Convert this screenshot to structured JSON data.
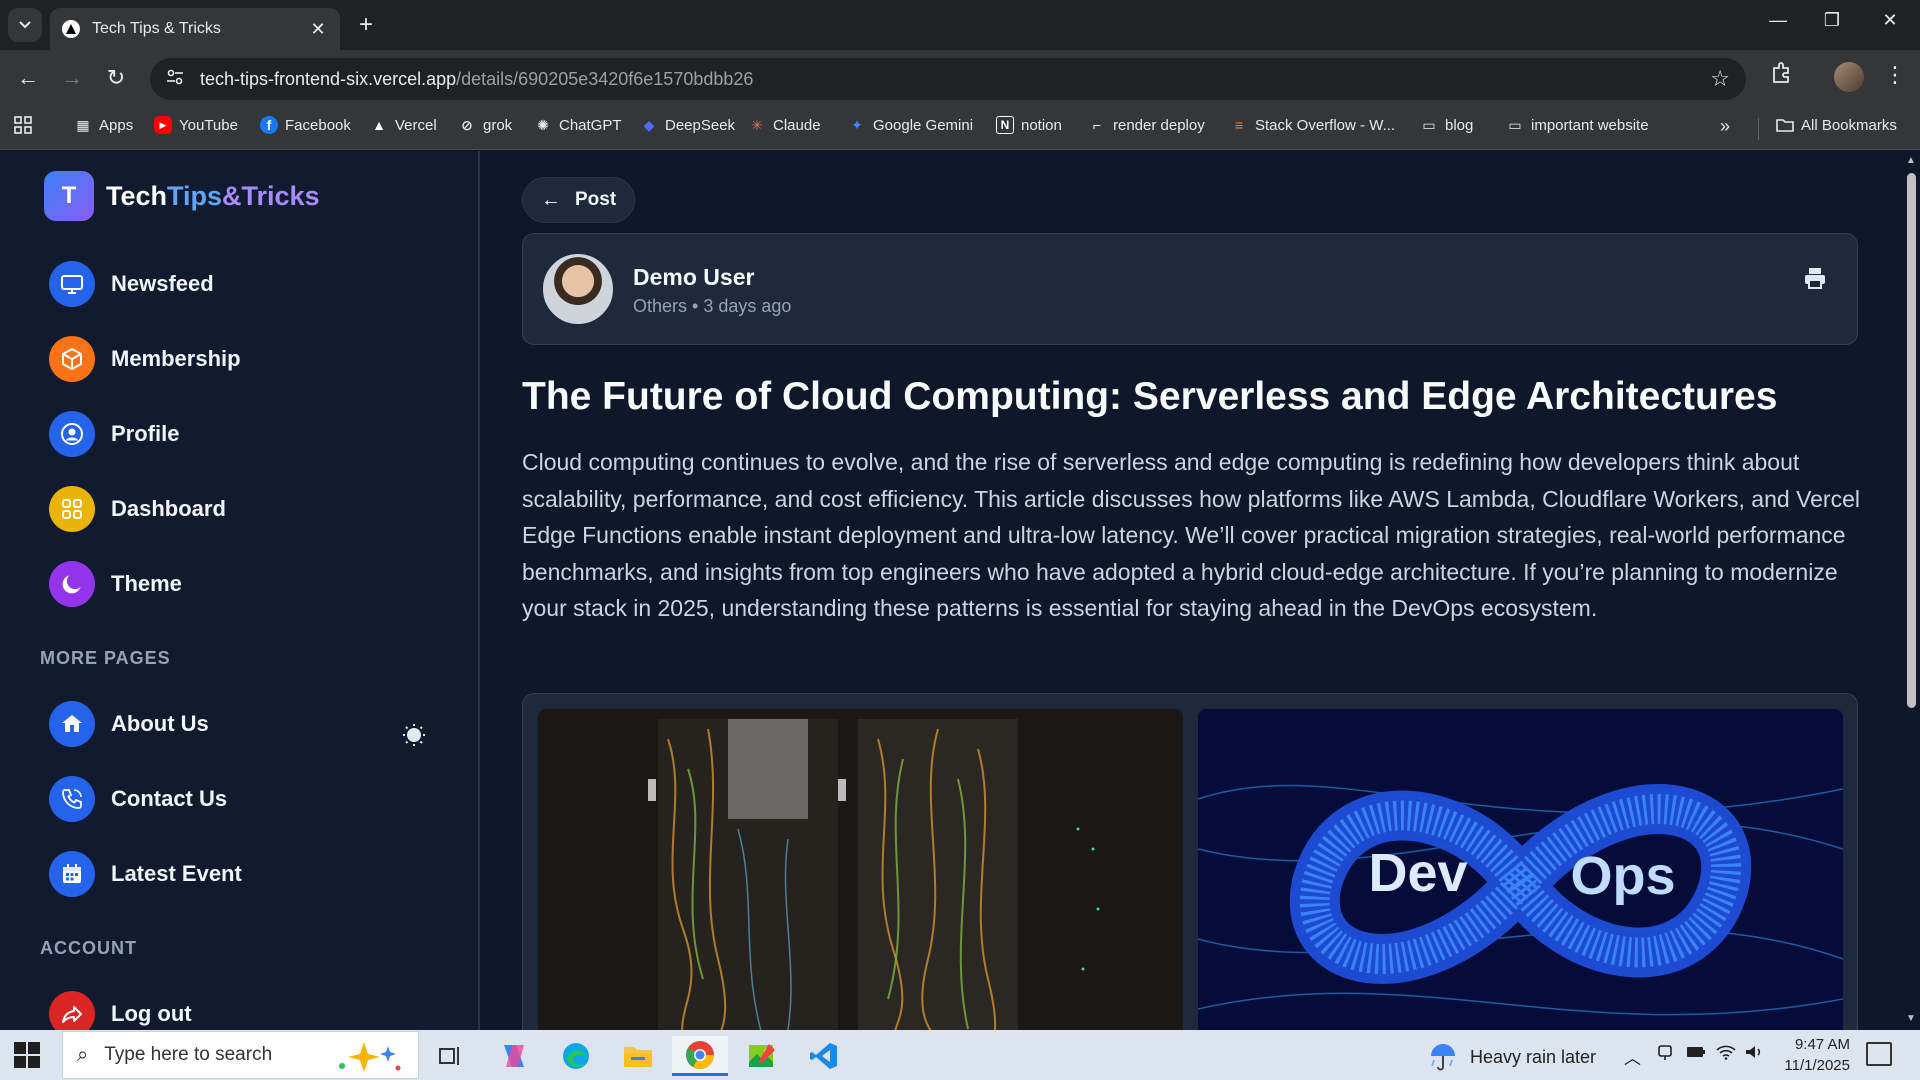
{
  "browser": {
    "tab_title": "Tech Tips & Tricks",
    "new_tab": "+",
    "url_host": "tech-tips-frontend-six.vercel.app",
    "url_path": "/details/690205e3420f6e1570bdbb26",
    "bookmarks": [
      {
        "label": "Apps",
        "icon": "apps-grid-icon",
        "color": "#e8eaed"
      },
      {
        "label": "YouTube",
        "icon": "youtube-icon",
        "color": "#ff0000"
      },
      {
        "label": "Facebook",
        "icon": "facebook-icon",
        "color": "#1877f2"
      },
      {
        "label": "Vercel",
        "icon": "vercel-icon",
        "color": "#ffffff"
      },
      {
        "label": "grok",
        "icon": "grok-icon",
        "color": "#e8eaed"
      },
      {
        "label": "ChatGPT",
        "icon": "chatgpt-icon",
        "color": "#e8eaed"
      },
      {
        "label": "DeepSeek",
        "icon": "deepseek-icon",
        "color": "#4d6bfe"
      },
      {
        "label": "Claude",
        "icon": "claude-icon",
        "color": "#d97757"
      },
      {
        "label": "Google Gemini",
        "icon": "gemini-icon",
        "color": "#4285f4"
      },
      {
        "label": "notion",
        "icon": "notion-icon",
        "color": "#ffffff"
      },
      {
        "label": "render deploy",
        "icon": "render-icon",
        "color": "#ffffff"
      },
      {
        "label": "Stack Overflow - W...",
        "icon": "stackoverflow-icon",
        "color": "#f48024"
      },
      {
        "label": "blog",
        "icon": "folder-icon",
        "color": "#e8eaed"
      },
      {
        "label": "important website",
        "icon": "folder-icon",
        "color": "#e8eaed"
      }
    ],
    "bookmarks_overflow": "»",
    "all_bookmarks": "All Bookmarks"
  },
  "logo": {
    "mark": "T",
    "part1": "Tech",
    "part2": "Tips",
    "part3": "&Tricks"
  },
  "sidebar": {
    "main_items": [
      {
        "label": "Newsfeed",
        "icon": "monitor-icon",
        "color": "#2563eb"
      },
      {
        "label": "Membership",
        "icon": "cube-icon",
        "color": "#f97316"
      },
      {
        "label": "Profile",
        "icon": "user-circle-icon",
        "color": "#2563eb"
      },
      {
        "label": "Dashboard",
        "icon": "grid-icon",
        "color": "#eab308"
      },
      {
        "label": "Theme",
        "icon": "moon-icon",
        "color": "#9333ea"
      }
    ],
    "more_pages_heading": "MORE PAGES",
    "more_items": [
      {
        "label": "About Us",
        "icon": "info-house-icon",
        "color": "#2563eb"
      },
      {
        "label": "Contact Us",
        "icon": "phone-icon",
        "color": "#2563eb"
      },
      {
        "label": "Latest Event",
        "icon": "calendar-icon",
        "color": "#2563eb"
      }
    ],
    "account_heading": "ACCOUNT",
    "account_items": [
      {
        "label": "Log out",
        "icon": "logout-icon",
        "color": "#dc2626"
      }
    ]
  },
  "post": {
    "back_label": "Post",
    "author_name": "Demo User",
    "category": "Others",
    "posted": "3 days ago",
    "title": "The Future of Cloud Computing: Serverless and Edge Architectures",
    "body": "Cloud computing continues to evolve, and the rise of serverless and edge computing is redefining how developers think about scalability, performance, and cost efficiency. This article discusses how platforms like AWS Lambda, Cloudflare Workers, and Vercel Edge Functions enable instant deployment and ultra-low latency. We’ll cover practical migration strategies, real-world performance benchmarks, and insights from top engineers who have adopted a hybrid cloud-edge architecture. If you’re planning to modernize your stack in 2025, understanding these patterns is essential for staying ahead in the DevOps ecosystem.",
    "image2_text_left": "Dev",
    "image2_text_right": "Ops"
  },
  "taskbar": {
    "search_placeholder": "Type here to search",
    "weather": "Heavy rain later",
    "time": "9:47 AM",
    "date": "11/1/2025"
  }
}
